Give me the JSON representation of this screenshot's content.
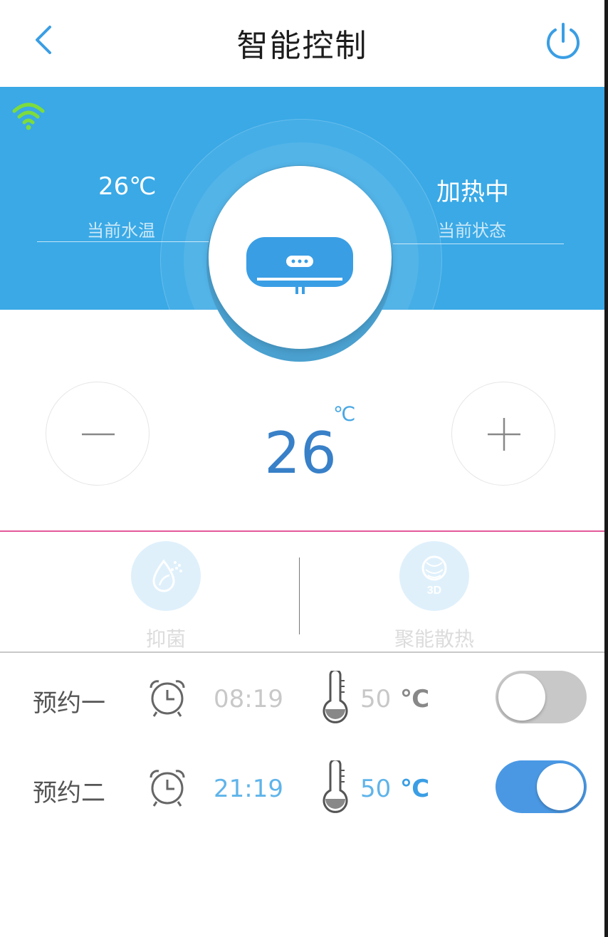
{
  "header": {
    "title": "智能控制"
  },
  "status": {
    "water_temp_value": "26℃",
    "water_temp_label": "当前水温",
    "state_value": "加热中",
    "state_label": "当前状态"
  },
  "control": {
    "temperature": "26",
    "unit": "℃"
  },
  "features": [
    {
      "label": "抑菌",
      "icon": "droplet-leaf-icon"
    },
    {
      "label": "聚能散热",
      "icon": "3d-heat-icon"
    }
  ],
  "schedules": [
    {
      "label": "预约一",
      "time": "08:19",
      "temp": "50",
      "unit": "℃",
      "enabled": false
    },
    {
      "label": "预约二",
      "time": "21:19",
      "temp": "50",
      "unit": "℃",
      "enabled": true
    }
  ],
  "colors": {
    "accent": "#3aa9e6",
    "temperature": "#3880c8",
    "wifi": "#7ddc3c",
    "toggle_on": "#4a98e4",
    "toggle_off": "#c8c8c8",
    "divider_pink": "#e45a9a"
  }
}
